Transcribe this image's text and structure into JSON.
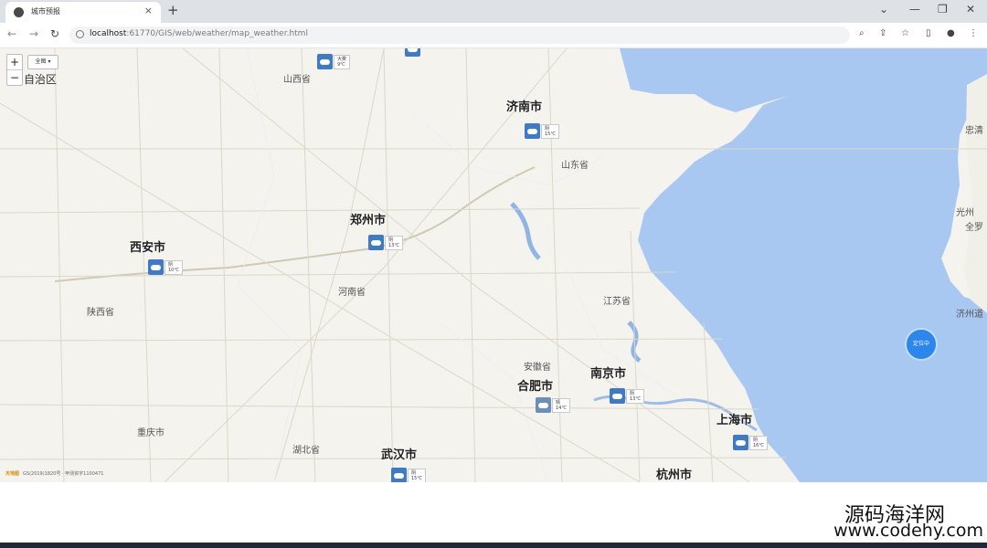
{
  "browser": {
    "tab_title": "城市预报",
    "url_host": "localhost",
    "url_path": ":61770/GIS/web/weather/map_weather.html",
    "new_tab": "+",
    "close": "×",
    "window_controls": [
      "⌄",
      "—",
      "❐",
      "✕"
    ],
    "toolbar_icons": [
      "search-icon",
      "share-icon",
      "star-icon",
      "sidebar-icon",
      "profile-icon",
      "menu-icon"
    ]
  },
  "map": {
    "zoom_in": "+",
    "zoom_out": "−",
    "layer_select": "全图 ▾",
    "top_left_region": "自治区",
    "marker_label": "定位中",
    "copyright_logo": "天地图",
    "copyright": "GS(2019)1820号 · 甲测资字1100471",
    "colors": {
      "sea": "#a8c8f2",
      "land": "#f4f3ee",
      "weather_icon": "#3d7bc9"
    },
    "cities": [
      {
        "name": "济南市",
        "weather": "阴",
        "temp": "15℃"
      },
      {
        "name": "郑州市",
        "weather": "阴",
        "temp": "13℃"
      },
      {
        "name": "西安市",
        "weather": "阴",
        "temp": "10℃"
      },
      {
        "name": "合肥市",
        "weather": "晴",
        "temp": "14℃"
      },
      {
        "name": "南京市",
        "weather": "阴",
        "temp": "13℃"
      },
      {
        "name": "上海市",
        "weather": "阴",
        "temp": "16℃"
      },
      {
        "name": "武汉市",
        "weather": "阴",
        "temp": "15℃"
      },
      {
        "name": "杭州市"
      }
    ],
    "top_weather": [
      {
        "weather": "大雾",
        "temp": "9℃"
      }
    ],
    "provinces": [
      "山西省",
      "山东省",
      "河南省",
      "陕西省",
      "江苏省",
      "安徽省",
      "重庆市",
      "湖北省"
    ],
    "edge_labels": [
      "忠清",
      "光州",
      "全罗",
      "济州道"
    ]
  },
  "watermark": {
    "line1": "源码海洋网",
    "line2": "www.codehy.com"
  }
}
